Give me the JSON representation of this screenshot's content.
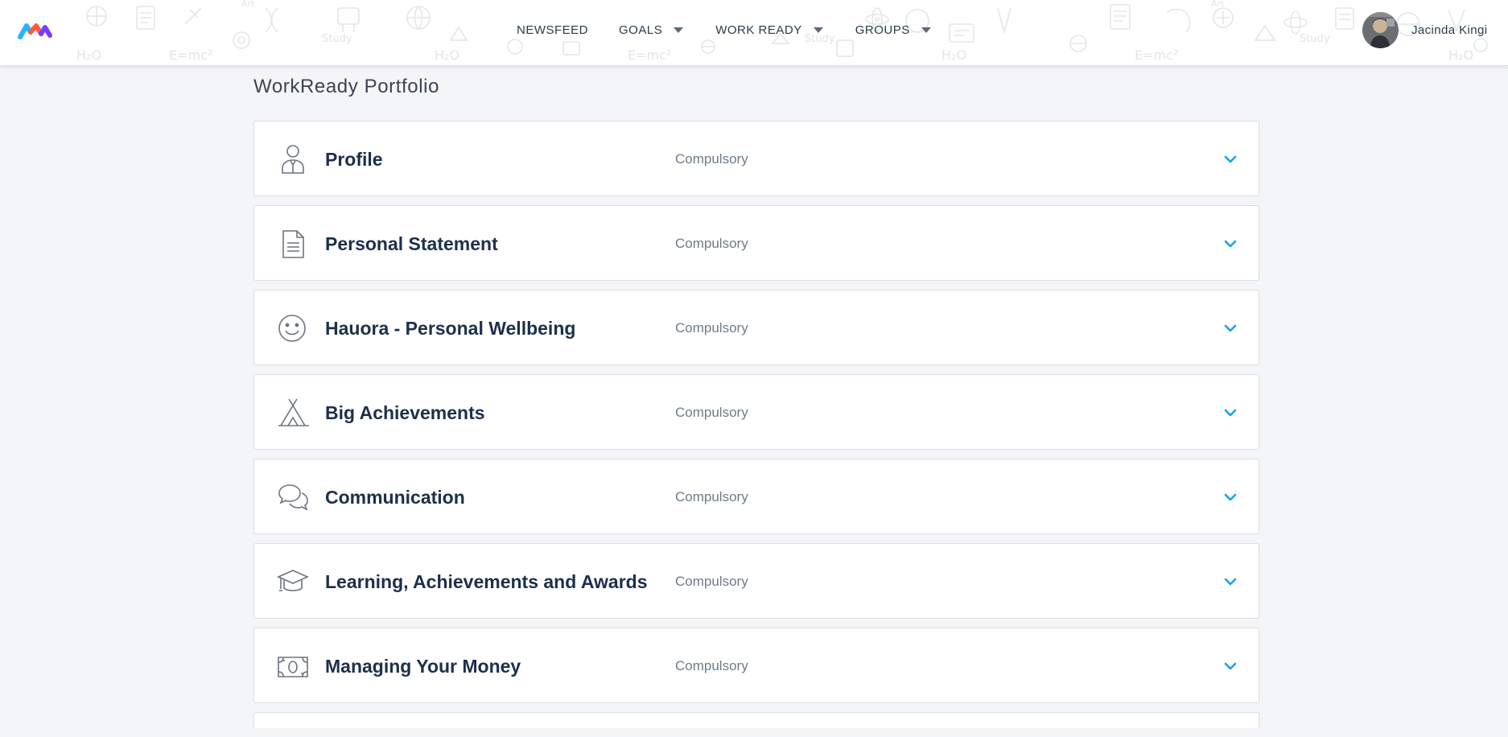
{
  "header": {
    "brand_colors": [
      "#23b4ff",
      "#ff5a3c",
      "#7b3cff"
    ],
    "nav": {
      "newsfeed": "NEWSFEED",
      "goals": "GOALS",
      "work_ready": "WORK READY",
      "groups": "GROUPS"
    },
    "user": {
      "name": "Jacinda Kingi",
      "avatar_icon": "avatar-photo"
    }
  },
  "main": {
    "title": "WorkReady Portfolio",
    "sections": [
      {
        "title": "Profile",
        "status": "Compulsory",
        "icon": "profile-person-icon"
      },
      {
        "title": "Personal Statement",
        "status": "Compulsory",
        "icon": "document-icon"
      },
      {
        "title": "Hauora - Personal Wellbeing",
        "status": "Compulsory",
        "icon": "smiley-face-icon"
      },
      {
        "title": "Big Achievements",
        "status": "Compulsory",
        "icon": "tent-icon"
      },
      {
        "title": "Communication",
        "status": "Compulsory",
        "icon": "speech-bubbles-icon"
      },
      {
        "title": "Learning, Achievements and Awards",
        "status": "Compulsory",
        "icon": "graduation-cap-icon"
      },
      {
        "title": "Managing Your Money",
        "status": "Compulsory",
        "icon": "banknote-icon"
      }
    ],
    "accent_color": "#1aa3e8"
  }
}
